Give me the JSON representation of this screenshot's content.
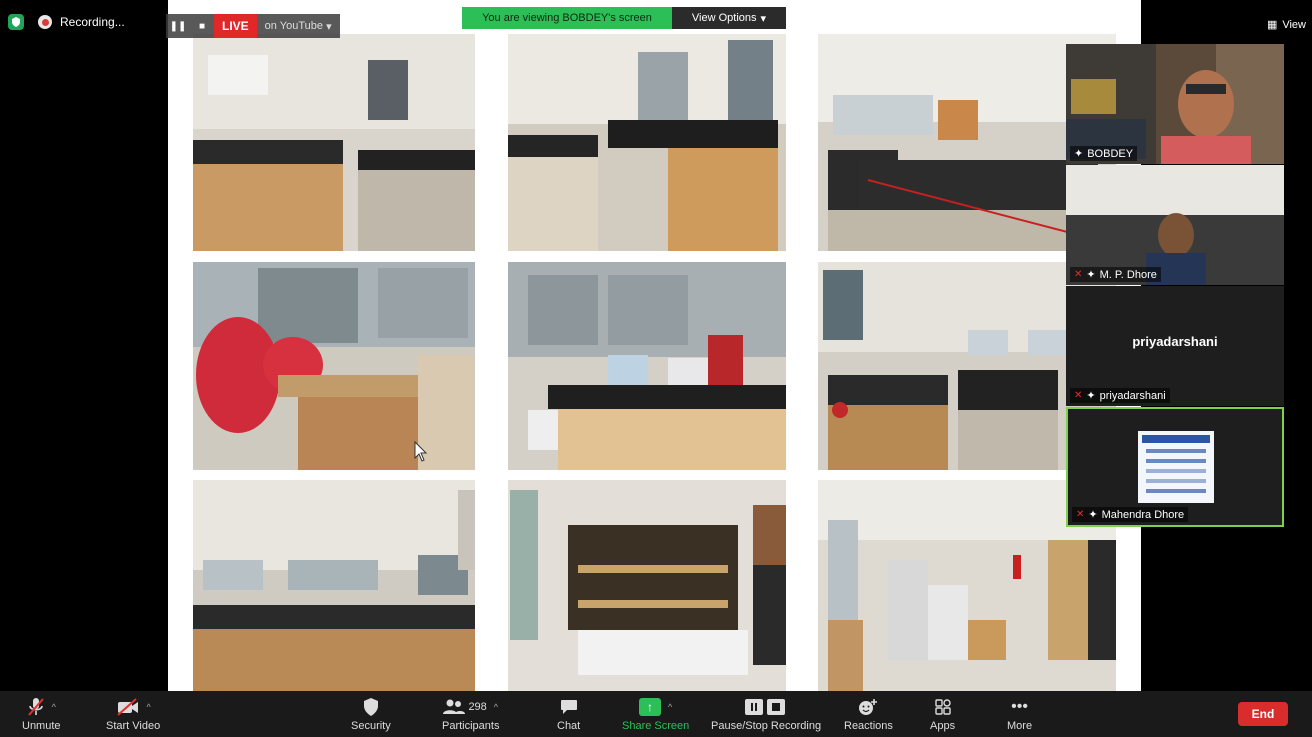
{
  "top": {
    "recording_label": "Recording...",
    "live_label": "LIVE",
    "live_target": "on YouTube",
    "viewing_message": "You are viewing BOBDEY's screen",
    "view_options_label": "View Options",
    "view_label": "View"
  },
  "gallery": [
    {
      "name": "BOBDEY",
      "muted": false
    },
    {
      "name": "M. P. Dhore",
      "muted": true
    },
    {
      "name": "priyadarshani",
      "muted": true,
      "display_name": "priyadarshani"
    },
    {
      "name": "Mahendra Dhore",
      "muted": true
    }
  ],
  "toolbar": {
    "unmute_label": "Unmute",
    "start_video_label": "Start Video",
    "security_label": "Security",
    "participants_label": "Participants",
    "participants_count": "298",
    "chat_label": "Chat",
    "share_screen_label": "Share Screen",
    "pause_stop_label": "Pause/Stop Recording",
    "reactions_label": "Reactions",
    "apps_label": "Apps",
    "more_label": "More",
    "end_label": "End"
  },
  "colors": {
    "accent_green": "#2dbf57",
    "end_red": "#d92d2d",
    "live_red": "#e02828",
    "toolbar_bg": "#1a1a1a"
  },
  "icons": {
    "shield": "security-shield-icon",
    "recording": "recording-dot-icon",
    "mic_off": "mic-muted-icon",
    "video_off": "video-off-icon",
    "participants": "people-icon",
    "chat": "chat-bubble-icon",
    "share": "share-screen-arrow-icon",
    "pause": "pause-icon",
    "stop": "stop-icon",
    "reactions": "smiley-plus-icon",
    "apps": "apps-icon",
    "more": "ellipsis-icon"
  }
}
